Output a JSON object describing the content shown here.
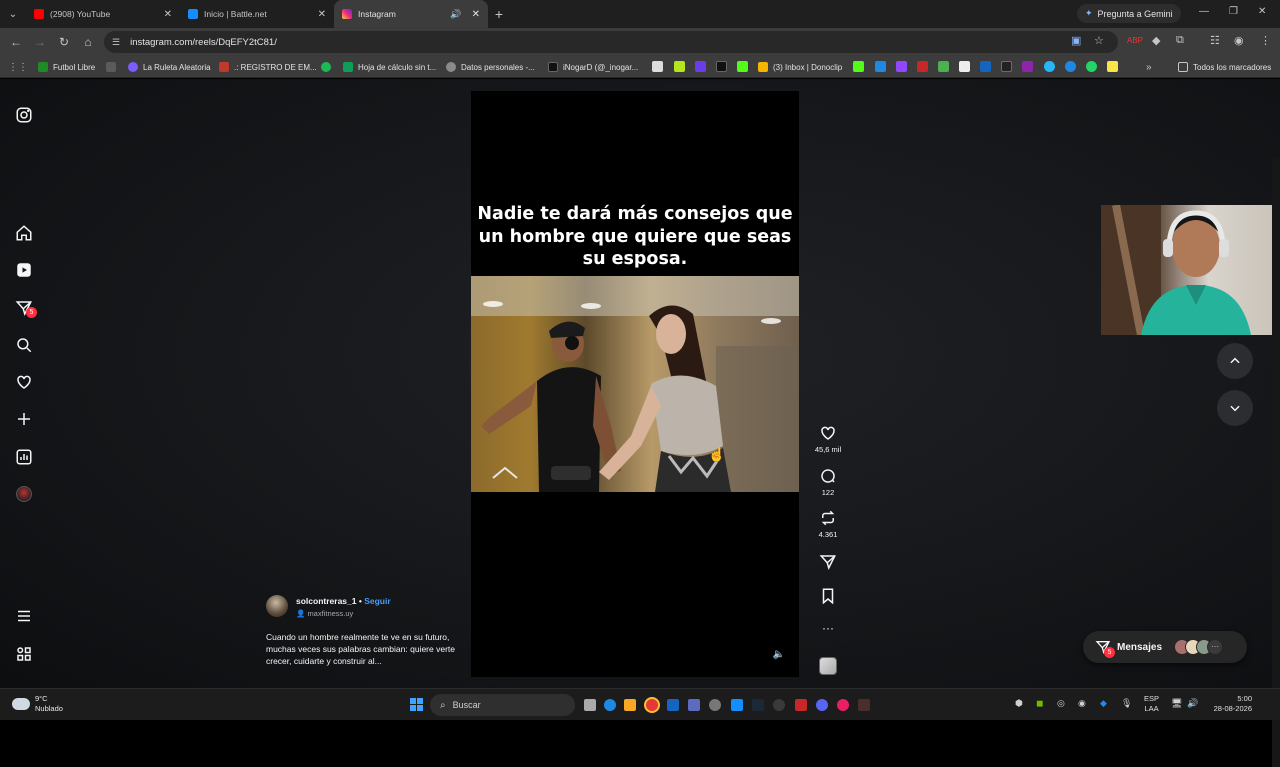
{
  "browser": {
    "tabs": [
      {
        "title": "(2908) YouTube",
        "color": "#ff0000",
        "active": false
      },
      {
        "title": "Inicio | Battle.net",
        "color": "#148eff",
        "active": false
      },
      {
        "title": "Instagram",
        "color": "#e1306c",
        "active": true
      }
    ],
    "gemini_label": "Pregunta a Gemini",
    "url": "instagram.com/reels/DqEFY2tC81/",
    "bookmarks": [
      {
        "label": "Futbol Libre",
        "color": "#1f8b24"
      },
      {
        "label": "La Ruleta Aleatoria",
        "color": "#7b5cff"
      },
      {
        "label": ".: REGISTRO DE EM...",
        "color": "#c0392b"
      },
      {
        "label": "Hoja de cálculo sin t...",
        "color": "#0f9d58"
      },
      {
        "label": "Datos personales -...",
        "color": "#8a8a8a"
      },
      {
        "label": "iNogarD (@_inogar...",
        "color": "#111111"
      },
      {
        "label": "(3) Inbox | Donoclip",
        "color": "#f4b400"
      }
    ],
    "all_bookmarks_label": "Todos los marcadores"
  },
  "reel": {
    "overlay_text": "Nadie te dará más consejos que un hombre que quiere que seas su esposa.",
    "likes": "45,6 mil",
    "comments": "122",
    "reposts": "4.361",
    "author": {
      "username": "solcontreras_1",
      "separator": "•",
      "follow_label": "Seguir",
      "subtitle": "maxfitness.uy"
    },
    "description": "Cuando un hombre realmente te ve en su futuro, muchas veces sus palabras cambian: quiere verte crecer, cuidarte y construir al..."
  },
  "sidebar": {
    "notifications_badge": "5"
  },
  "messages": {
    "label": "Mensajes",
    "badge": "5"
  },
  "taskbar": {
    "temperature": "9°C",
    "weather": "Nublado",
    "search_placeholder": "Buscar",
    "lang_top": "ESP",
    "lang_bottom": "LAA",
    "time": "5:00",
    "date": "28-08-2026"
  }
}
